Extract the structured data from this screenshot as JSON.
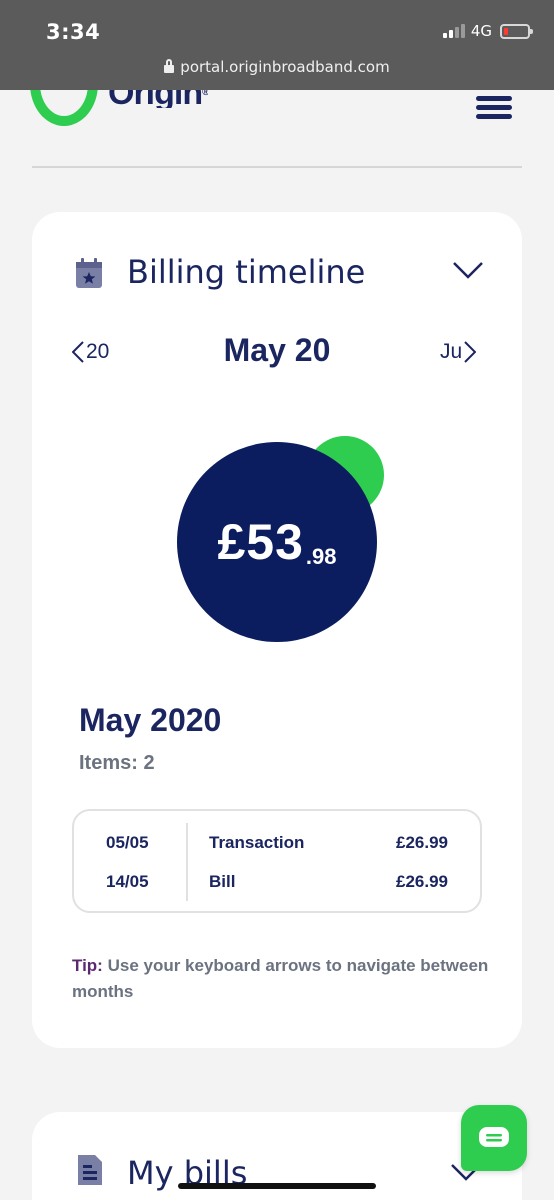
{
  "status_bar": {
    "time": "3:34",
    "network": "4G"
  },
  "browser": {
    "url": "portal.originbroadband.com"
  },
  "header": {
    "logo_text": "Origin",
    "logo_mark": "®"
  },
  "billing_timeline": {
    "title": "Billing timeline",
    "prev_month": "20",
    "current_month": "May 20",
    "next_month": "Ju",
    "total_major": "£53",
    "total_minor": ".98",
    "period_title": "May 2020",
    "items_count": "Items: 2",
    "transactions": [
      {
        "date": "05/05",
        "description": "Transaction",
        "amount": "£26.99"
      },
      {
        "date": "14/05",
        "description": "Bill",
        "amount": "£26.99"
      }
    ],
    "tip_label": "Tip:",
    "tip_text": " Use your keyboard arrows to navigate between months"
  },
  "my_bills": {
    "title": "My bills"
  },
  "colors": {
    "brand_green": "#2ecc4f",
    "navy": "#0b1d5e",
    "tip_purple": "#5b2a6e"
  }
}
